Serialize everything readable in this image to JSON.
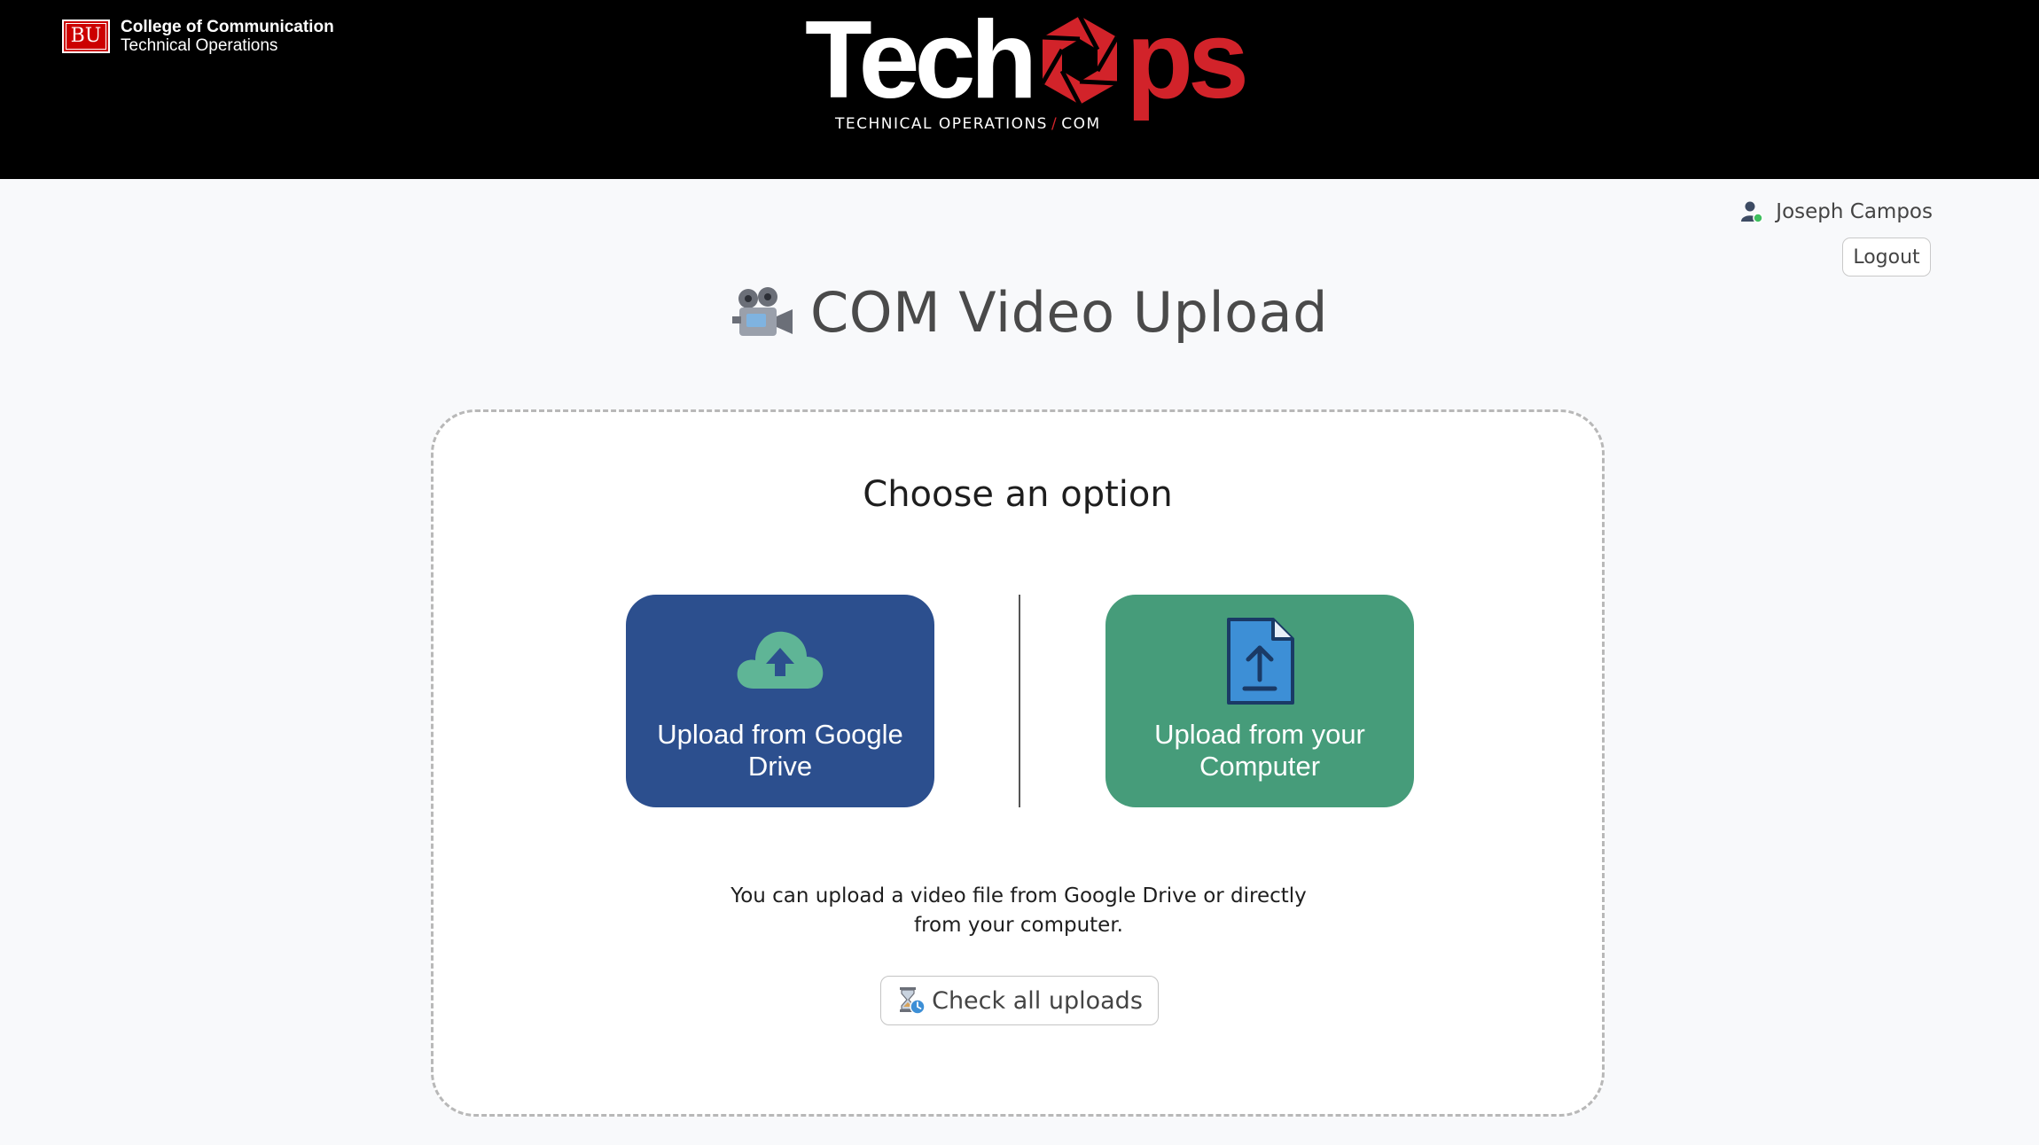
{
  "header": {
    "bu_logo_text": "BU",
    "college_line1": "College of Communication",
    "college_line2": "Technical Operations",
    "logo_word_tech": "Tech",
    "logo_word_ps": "ps",
    "logo_subtitle_left": "TECHNICAL OPERATIONS",
    "logo_subtitle_slash": "/",
    "logo_subtitle_right": "COM",
    "brand_red": "#d2232a"
  },
  "user": {
    "name": "Joseph Campos",
    "logout_label": "Logout"
  },
  "page": {
    "title": "COM Video Upload",
    "title_icon": "movie-camera-icon"
  },
  "upload_card": {
    "heading": "Choose an option",
    "options": [
      {
        "label": "Upload from Google Drive",
        "icon": "cloud-upload-icon",
        "color": "#2c4f8e"
      },
      {
        "label": "Upload from your Computer",
        "icon": "file-upload-icon",
        "color": "#469c7a"
      }
    ],
    "description": "You can upload a video file from Google Drive or directly from your computer.",
    "check_uploads_label": "Check all uploads",
    "check_uploads_icon": "hourglass-clock-icon"
  }
}
